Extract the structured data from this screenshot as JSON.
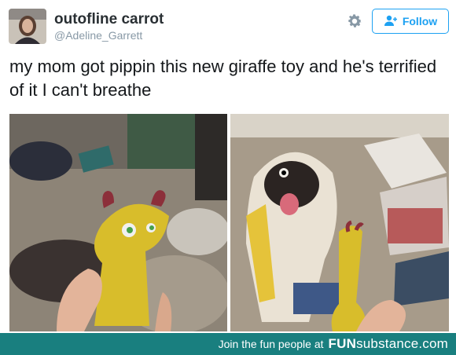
{
  "tweet": {
    "display_name": "outofline carrot",
    "handle": "@Adeline_Garrett",
    "text": "my mom got pippin this new giraffe toy and he's terrified of it I can't breathe",
    "follow_label": "Follow"
  },
  "footer": {
    "tagline": "Join the fun people at",
    "brand_bold": "FUN",
    "brand_rest": "substance",
    "brand_tld": ".com"
  },
  "colors": {
    "follow_blue": "#1da1f2",
    "footer_teal": "#197f7f"
  },
  "icons": [
    "gear-icon",
    "add-user-icon"
  ]
}
